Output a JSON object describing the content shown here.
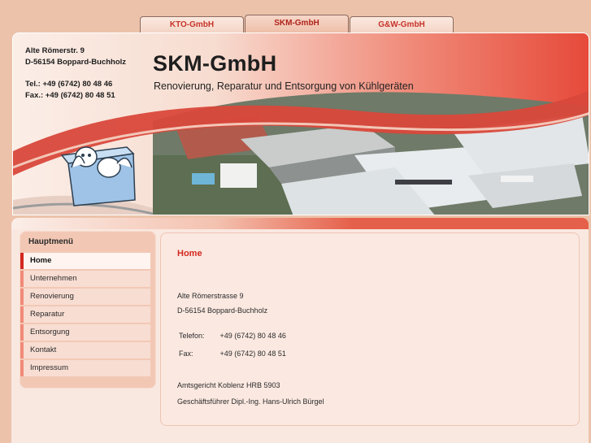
{
  "tabs": [
    "KTO-GmbH",
    "SKM-GmbH",
    "G&W-GmbH"
  ],
  "header": {
    "address_line1": "Alte Römerstr. 9",
    "address_line2": "D-56154 Boppard-Buchholz",
    "tel": "Tel.:  +49 (6742) 80 48 46",
    "fax": "Fax.: +49 (6742) 80 48 51",
    "title": "SKM-GmbH",
    "subtitle": "Renovierung, Reparatur und Entsorgung von Kühlgeräten"
  },
  "sidebar": {
    "title": "Hauptmenü",
    "items": [
      "Home",
      "Unternehmen",
      "Renovierung",
      "Reparatur",
      "Entsorgung",
      "Kontakt",
      "Impressum"
    ],
    "active_index": 0
  },
  "main": {
    "heading": "Home",
    "street": "Alte Römerstrasse 9",
    "city": "D-56154 Boppard-Buchholz",
    "phone_label": "Telefon:",
    "phone_value": "+49 (6742) 80 48 46",
    "fax_label": "Fax:",
    "fax_value": "+49 (6742) 80 48 51",
    "court": "Amtsgericht Koblenz HRB 5903",
    "manager": "Geschäftsführer Dipl.-Ing. Hans-Ulrich Bürgel"
  },
  "colors": {
    "accent": "#d3281f",
    "background": "#ecc3aa",
    "header_gradient_end": "#e64a3a"
  },
  "icons": {
    "mascot": "cartoon-fridge-mascot-illustration",
    "photo": "aerial-photo-of-industrial-buildings"
  }
}
